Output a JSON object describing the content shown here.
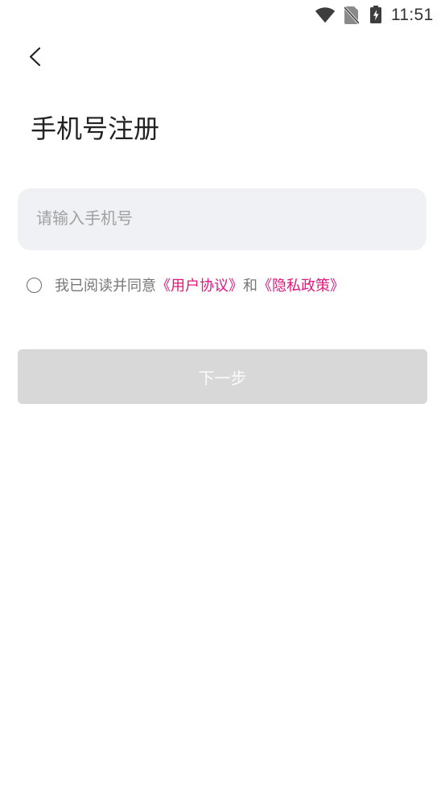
{
  "status_bar": {
    "time": "11:51",
    "icons": {
      "wifi": "wifi-icon",
      "sim": "no-sim-icon",
      "battery": "battery-charging-icon"
    }
  },
  "header": {
    "back_icon": "chevron-left-icon"
  },
  "title": "手机号注册",
  "phone_input": {
    "placeholder": "请输入手机号",
    "value": ""
  },
  "agreement": {
    "checked": false,
    "prefix": "我已阅读并同意",
    "user_agreement": "《用户协议》",
    "conjunction": "和",
    "privacy_policy": "《隐私政策》"
  },
  "next_button": {
    "label": "下一步",
    "enabled": false
  },
  "colors": {
    "accent": "#e3167c",
    "title_text": "#222222",
    "muted_text": "#777777",
    "input_bg": "#f0f1f5",
    "button_disabled_bg": "#d8d8d8",
    "button_disabled_text": "#fbfbfb"
  }
}
